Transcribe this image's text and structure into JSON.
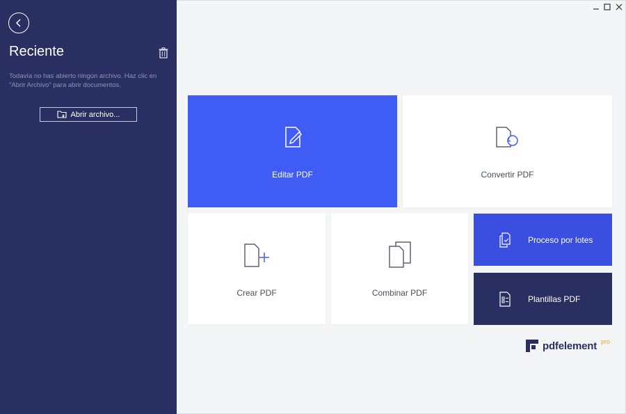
{
  "sidebar": {
    "title": "Reciente",
    "empty_message": "Todavía no has abierto ningún archivo. Haz clic en \"Abrir Archivo\" para abrir documentos.",
    "open_button_label": "Abrir archivo...",
    "icons": {
      "back": "back-arrow-icon",
      "trash": "trash-icon",
      "folder": "folder-open-icon"
    }
  },
  "tiles": {
    "edit": {
      "label": "Editar PDF",
      "icon": "edit-pdf-icon"
    },
    "convert": {
      "label": "Convertir PDF",
      "icon": "convert-pdf-icon"
    },
    "create": {
      "label": "Crear PDF",
      "icon": "create-pdf-icon"
    },
    "combine": {
      "label": "Combinar PDF",
      "icon": "combine-pdf-icon"
    },
    "batch": {
      "label": "Proceso por lotes",
      "icon": "batch-process-icon"
    },
    "templates": {
      "label": "Plantillas PDF",
      "icon": "templates-icon"
    }
  },
  "brand": {
    "name": "pdfelement",
    "edition": "pro"
  },
  "colors": {
    "sidebar": "#2a2f61",
    "accent_blue": "#3f5df5",
    "batch_blue": "#3a4ee0",
    "brand_orange": "#f5a623"
  }
}
